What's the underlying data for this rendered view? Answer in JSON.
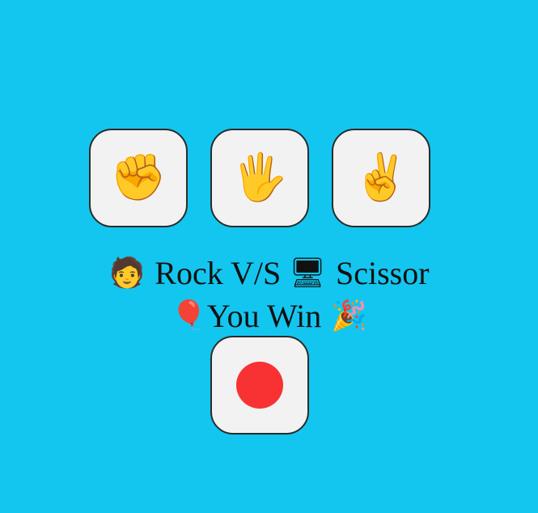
{
  "choices": [
    {
      "name": "rock",
      "icon": "✊"
    },
    {
      "name": "paper",
      "icon": "🖐"
    },
    {
      "name": "scissor",
      "icon": "✌"
    }
  ],
  "matchup": {
    "player_icon": "🧑",
    "player_choice": "Rock",
    "vs_label": "V/S",
    "computer_icon": "🖥",
    "computer_choice": "Scissor"
  },
  "outcome": {
    "left_icon": "🎈",
    "text": "You Win",
    "right_icon": "🎉"
  },
  "record_button": {
    "dot_color": "#f83232"
  },
  "colors": {
    "background": "#13c6ef",
    "button_bg": "#f2f2f2"
  }
}
